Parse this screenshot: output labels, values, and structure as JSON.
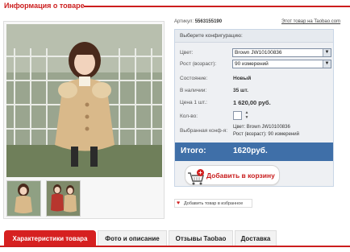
{
  "header": {
    "title": "Информация о товаре"
  },
  "product": {
    "article_label": "Артикул:",
    "article_value": "5563155190",
    "taobao_link": "Этот товар на Taobao.com"
  },
  "config": {
    "heading": "Выберите конфигурацию:",
    "color_label": "Цвет:",
    "color_value": "Brown JW10100836",
    "size_label": "Рост (возраст):",
    "size_value": "90 измерений",
    "condition_label": "Состояние:",
    "condition_value": "Новый",
    "stock_label": "В наличии:",
    "stock_value": "35 шт.",
    "price_label": "Цена 1 шт.:",
    "price_value": "1 620,00 руб.",
    "qty_label": "Кол-во:",
    "selected_label": "Выбранная конф-я:",
    "selected_color": "Цвет: Brown JW10100836",
    "selected_size": "Рост (возраст): 90 измерений",
    "total_label": "Итого:",
    "total_value": "1620руб.",
    "cart_button": "Добавить в корзину",
    "favorites_link": "Добавить товар в избранное"
  },
  "tabs": [
    {
      "label": "Характеристики товара"
    },
    {
      "label": "Фото и описание"
    },
    {
      "label": "Отзывы Taobao"
    },
    {
      "label": "Доставка"
    }
  ],
  "colors": {
    "accent_red": "#cc1e1e",
    "total_bar": "#3f6fa8",
    "panel_bg": "#eef0f3"
  }
}
